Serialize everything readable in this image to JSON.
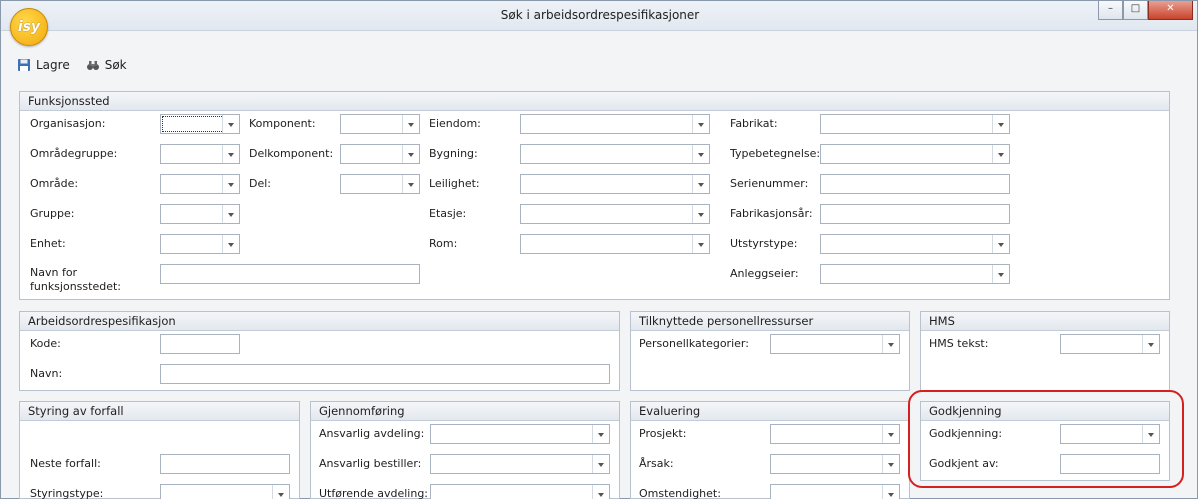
{
  "window": {
    "title": "Søk i arbeidsordrespesifikasjoner",
    "logo_text": "isy",
    "minimize_glyph": "–",
    "maximize_glyph": "□",
    "close_glyph": "✕"
  },
  "toolbar": {
    "save_label": "Lagre",
    "search_label": "Søk"
  },
  "funksjonssted": {
    "title": "Funksjonssted",
    "organisasjon": "Organisasjon:",
    "omradegruppe": "Områdegruppe:",
    "omrade": "Område:",
    "gruppe": "Gruppe:",
    "enhet": "Enhet:",
    "navn_line1": "Navn for",
    "navn_line2": "funksjonsstedet:",
    "komponent": "Komponent:",
    "delkomponent": "Delkomponent:",
    "del": "Del:",
    "eiendom": "Eiendom:",
    "bygning": "Bygning:",
    "leilighet": "Leilighet:",
    "etasje": "Etasje:",
    "rom": "Rom:",
    "fabrikat": "Fabrikat:",
    "typebetegnelse": "Typebetegnelse:",
    "serienummer": "Serienummer:",
    "fabrikasjonsar": "Fabrikasjonsår:",
    "utstyrstype": "Utstyrstype:",
    "anleggseier": "Anleggseier:"
  },
  "arbeidsordrespesifikasjon": {
    "title": "Arbeidsordrespesifikasjon",
    "kode": "Kode:",
    "navn": "Navn:"
  },
  "personell": {
    "title": "Tilknyttede personellressurser",
    "personellkategorier": "Personellkategorier:"
  },
  "hms": {
    "title": "HMS",
    "hms_tekst": "HMS tekst:"
  },
  "styring": {
    "title": "Styring av forfall",
    "neste_forfall": "Neste forfall:",
    "styringstype": "Styringstype:"
  },
  "gjennomforing": {
    "title": "Gjennomføring",
    "ansvarlig_avdeling": "Ansvarlig avdeling:",
    "ansvarlig_bestiller": "Ansvarlig bestiller:",
    "utforende_avdeling": "Utførende avdeling:"
  },
  "evaluering": {
    "title": "Evaluering",
    "prosjekt": "Prosjekt:",
    "arsak": "Årsak:",
    "omstendighet": "Omstendighet:"
  },
  "godkjenning": {
    "title": "Godkjenning",
    "godkjenning": "Godkjenning:",
    "godkjent_av": "Godkjent av:"
  },
  "colors": {
    "highlight": "#d62020",
    "logo": "#f3a90c"
  }
}
